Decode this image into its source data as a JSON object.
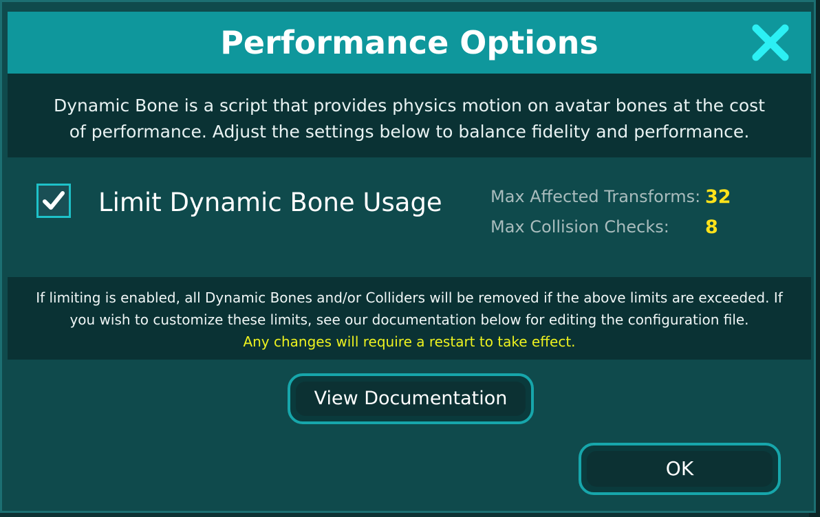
{
  "dialog": {
    "title": "Performance Options",
    "description": "Dynamic Bone is a script that provides physics motion on avatar bones at the cost of performance.  Adjust the settings below to balance fidelity and performance.",
    "close_icon": "close-x-icon",
    "checkbox": {
      "label": "Limit Dynamic Bone Usage",
      "checked": true
    },
    "stats": [
      {
        "label": "Max Affected Transforms:",
        "value": "32"
      },
      {
        "label": "Max Collision Checks:",
        "value": "8"
      }
    ],
    "note": "If limiting is enabled, all Dynamic Bones and/or Colliders will be removed if the above limits are exceeded.  If you wish to customize these limits, see our documentation below for editing the configuration file.",
    "warning": "Any changes will require a restart to take effect.",
    "doc_button": "View Documentation",
    "ok_button": "OK"
  },
  "colors": {
    "header": "#0f979c",
    "accent": "#1ec2c9",
    "value_yellow": "#ffe21a",
    "warning_yellow": "#eef21f"
  }
}
